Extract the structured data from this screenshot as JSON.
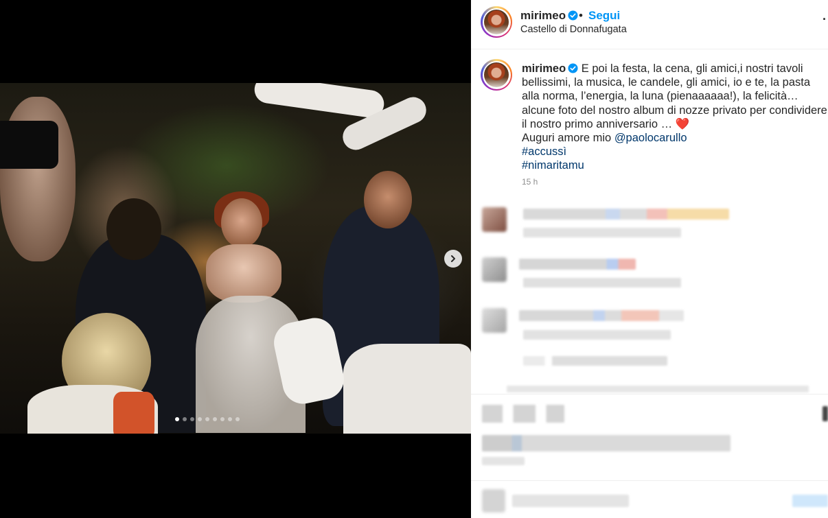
{
  "post": {
    "username": "mirimeo",
    "follow_label": "Segui",
    "separator": "•",
    "location": "Castello di Donnafugata",
    "more_label": "·"
  },
  "caption": {
    "username": "mirimeo",
    "text": "E poi la festa, la cena, gli amici,i nostri tavoli bellissimi, la musica, le candele, gli amici, io e te, la pasta alla norma, l’energia, la luna (pienaaaaaa!), la felicità… alcune foto del nostro album di nozze privato per condividere il nostro primo anniversario … ",
    "heart": "❤️",
    "line2_prefix": "Auguri amore mio ",
    "mention": "@paolocarullo",
    "hashtag1": "#accussì",
    "hashtag2": "#nimaritamu",
    "timestamp": "15 h"
  },
  "carousel": {
    "total_slides": 9,
    "active_index": 0
  },
  "colors": {
    "accent": "#0095f6",
    "link": "#00376b",
    "verified": "#0095f6"
  },
  "icons": {
    "next": "chevron-right-icon",
    "verified": "verified-badge-icon"
  }
}
